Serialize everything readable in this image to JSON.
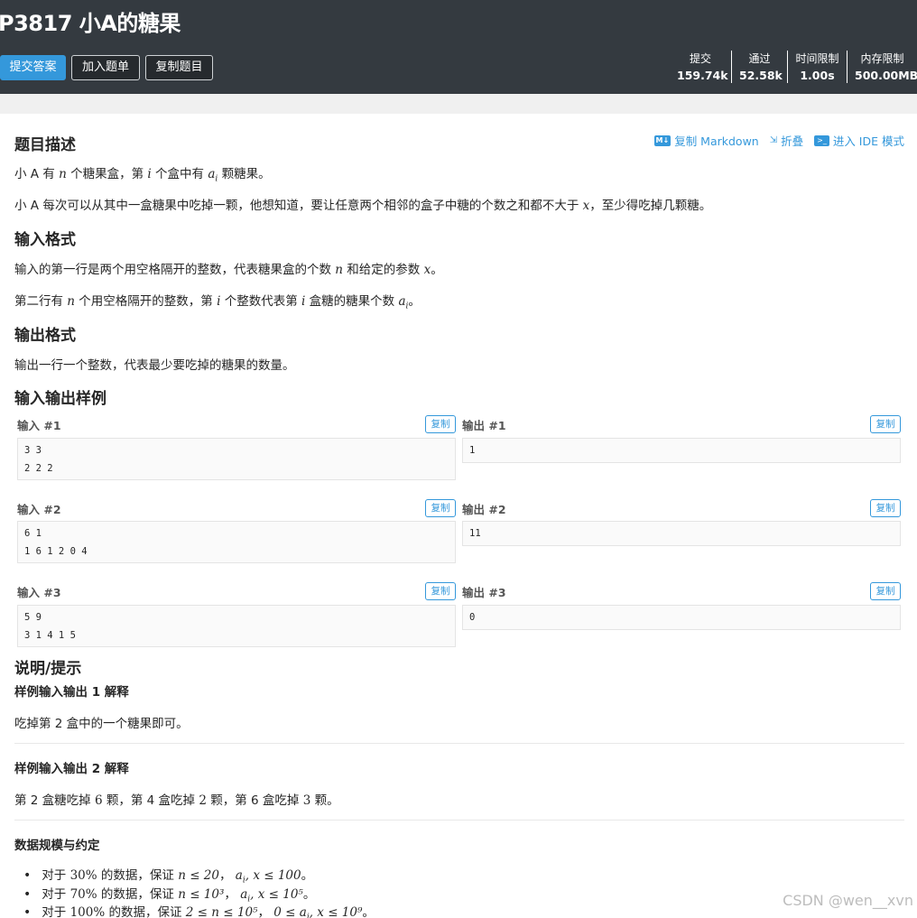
{
  "header": {
    "title": "P3817 小A的糖果",
    "buttons": {
      "submit": "提交答案",
      "add_list": "加入题单",
      "copy_problem": "复制题目"
    },
    "stats": [
      {
        "label": "提交",
        "value": "159.74k"
      },
      {
        "label": "通过",
        "value": "52.58k"
      },
      {
        "label": "时间限制",
        "value": "1.00s"
      },
      {
        "label": "内存限制",
        "value": "500.00MB"
      }
    ]
  },
  "toolbar": {
    "copy_markdown": "复制 Markdown",
    "fold": "折叠",
    "ide": "进入 IDE 模式"
  },
  "sections": {
    "description": "题目描述",
    "input_format": "输入格式",
    "output_format": "输出格式",
    "samples": "输入输出样例",
    "hint": "说明/提示"
  },
  "description": {
    "p1_a": "小 A 有",
    "p1_b": "个糖果盒，第",
    "p1_c": "个盒中有",
    "p1_d": "颗糖果。",
    "p2_a": "小 A 每次可以从其中一盒糖果中吃掉一颗，他想知道，要让任意两个相邻的盒子中糖的个数之和都不大于",
    "p2_b": "，至少得吃掉几颗糖。"
  },
  "input_format": {
    "p1_a": "输入的第一行是两个用空格隔开的整数，代表糖果盒的个数",
    "p1_b": "和给定的参数",
    "p1_c": "。",
    "p2_a": "第二行有",
    "p2_b": "个用空格隔开的整数，第",
    "p2_c": "个整数代表第",
    "p2_d": "盒糖的糖果个数",
    "p2_e": "。"
  },
  "output_format": {
    "p1": "输出一行一个整数，代表最少要吃掉的糖果的数量。"
  },
  "math": {
    "n": "n",
    "i": "i",
    "a": "a",
    "sub_i": "i",
    "x": "x"
  },
  "copy_label": "复制",
  "samples": [
    {
      "in_label": "输入 #1",
      "out_label": "输出 #1",
      "input": "3 3\n2 2 2",
      "output": "1"
    },
    {
      "in_label": "输入 #2",
      "out_label": "输出 #2",
      "input": "6 1\n1 6 1 2 0 4",
      "output": "11"
    },
    {
      "in_label": "输入 #3",
      "out_label": "输出 #3",
      "input": "5 9\n3 1 4 1 5",
      "output": "0"
    }
  ],
  "hint": {
    "ex1_title": "样例输入输出 1 解释",
    "ex1_text": "吃掉第 2 盒中的一个糖果即可。",
    "ex2_title": "样例输入输出 2 解释",
    "ex2_text_a": "第 2 盒糖吃掉",
    "ex2_n1": "6",
    "ex2_text_b": "颗，第 4 盒吃掉",
    "ex2_n2": "2",
    "ex2_text_c": "颗，第 6 盒吃掉",
    "ex2_n3": "3",
    "ex2_text_d": "颗。",
    "scale_title": "数据规模与约定",
    "constraints": [
      {
        "a": "对于",
        "pct": "30%",
        "b": "的数据，保证",
        "c1": "n ≤ 20",
        "sep": "，",
        "c2": "a",
        "c2sub": "i",
        "c2b": ", x ≤ 100",
        "end": "。"
      },
      {
        "a": "对于",
        "pct": "70%",
        "b": "的数据，保证",
        "c1": "n ≤ 10³",
        "sep": "，",
        "c2": "a",
        "c2sub": "i",
        "c2b": ", x ≤ 10⁵",
        "end": "。"
      },
      {
        "a": "对于",
        "pct": "100%",
        "b": "的数据，保证",
        "c1": "2 ≤ n ≤ 10⁵",
        "sep": "，",
        "c2": "0 ≤ a",
        "c2sub": "i",
        "c2b": ", x ≤ 10⁹",
        "end": "。"
      }
    ]
  },
  "watermark": "CSDN @wen__xvn"
}
